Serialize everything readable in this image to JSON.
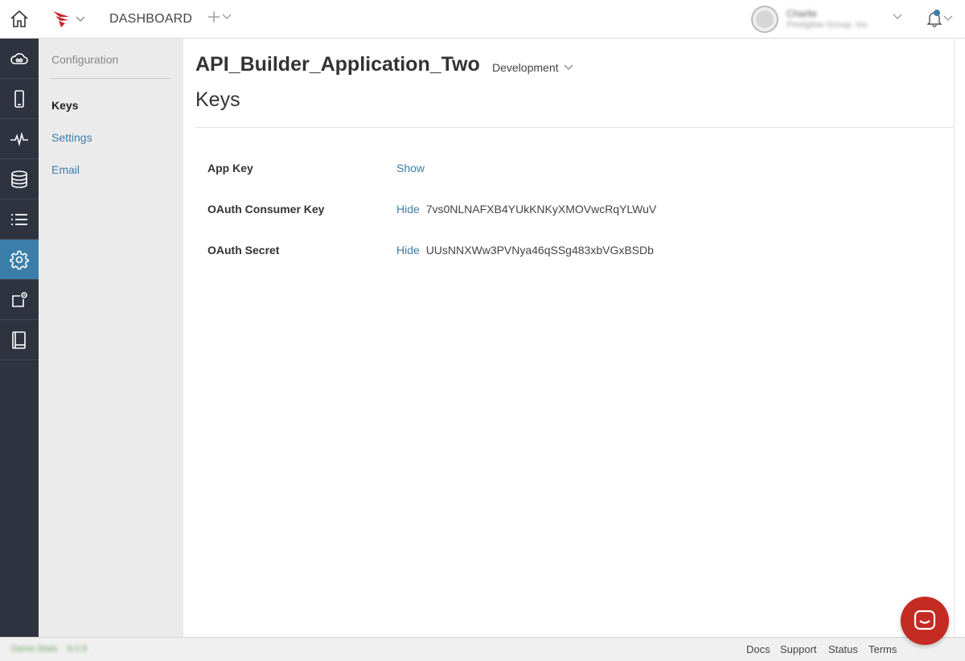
{
  "topbar": {
    "dashboard_label": "DASHBOARD",
    "add_icon": "plus-icon",
    "user": {
      "name": "Charlie",
      "org": "Pixelglow Group, Inc."
    }
  },
  "rail": {
    "items": [
      "home-icon",
      "cloud-icon",
      "mobile-icon",
      "analytics-pulse-icon",
      "database-icon",
      "list-icon",
      "gear-icon",
      "new-window-icon",
      "book-icon"
    ],
    "active": "gear-icon"
  },
  "subnav": {
    "section_title": "Configuration",
    "items": [
      {
        "label": "Keys",
        "active": true
      },
      {
        "label": "Settings",
        "active": false
      },
      {
        "label": "Email",
        "active": false
      }
    ]
  },
  "main": {
    "app_title": "API_Builder_Application_Two",
    "environment": "Development",
    "section_title": "Keys",
    "keys": [
      {
        "label": "App Key",
        "action": "Show",
        "value": ""
      },
      {
        "label": "OAuth Consumer Key",
        "action": "Hide",
        "value": "7vs0NLNAFXB4YUkKNKyXMOVwcRqYLWuV"
      },
      {
        "label": "OAuth Secret",
        "action": "Hide",
        "value": "UUsNNXWw3PVNya46qSSg483xbVGxBSDb"
      }
    ]
  },
  "footer": {
    "status_text": "Demo Stats",
    "version": "6.0.9",
    "links": [
      "Docs",
      "Support",
      "Status",
      "Terms"
    ]
  },
  "colors": {
    "accent": "#3b7ea9",
    "rail_bg": "#2f3340",
    "chat_bg": "#c42b22",
    "brand_red": "#c8262d"
  }
}
